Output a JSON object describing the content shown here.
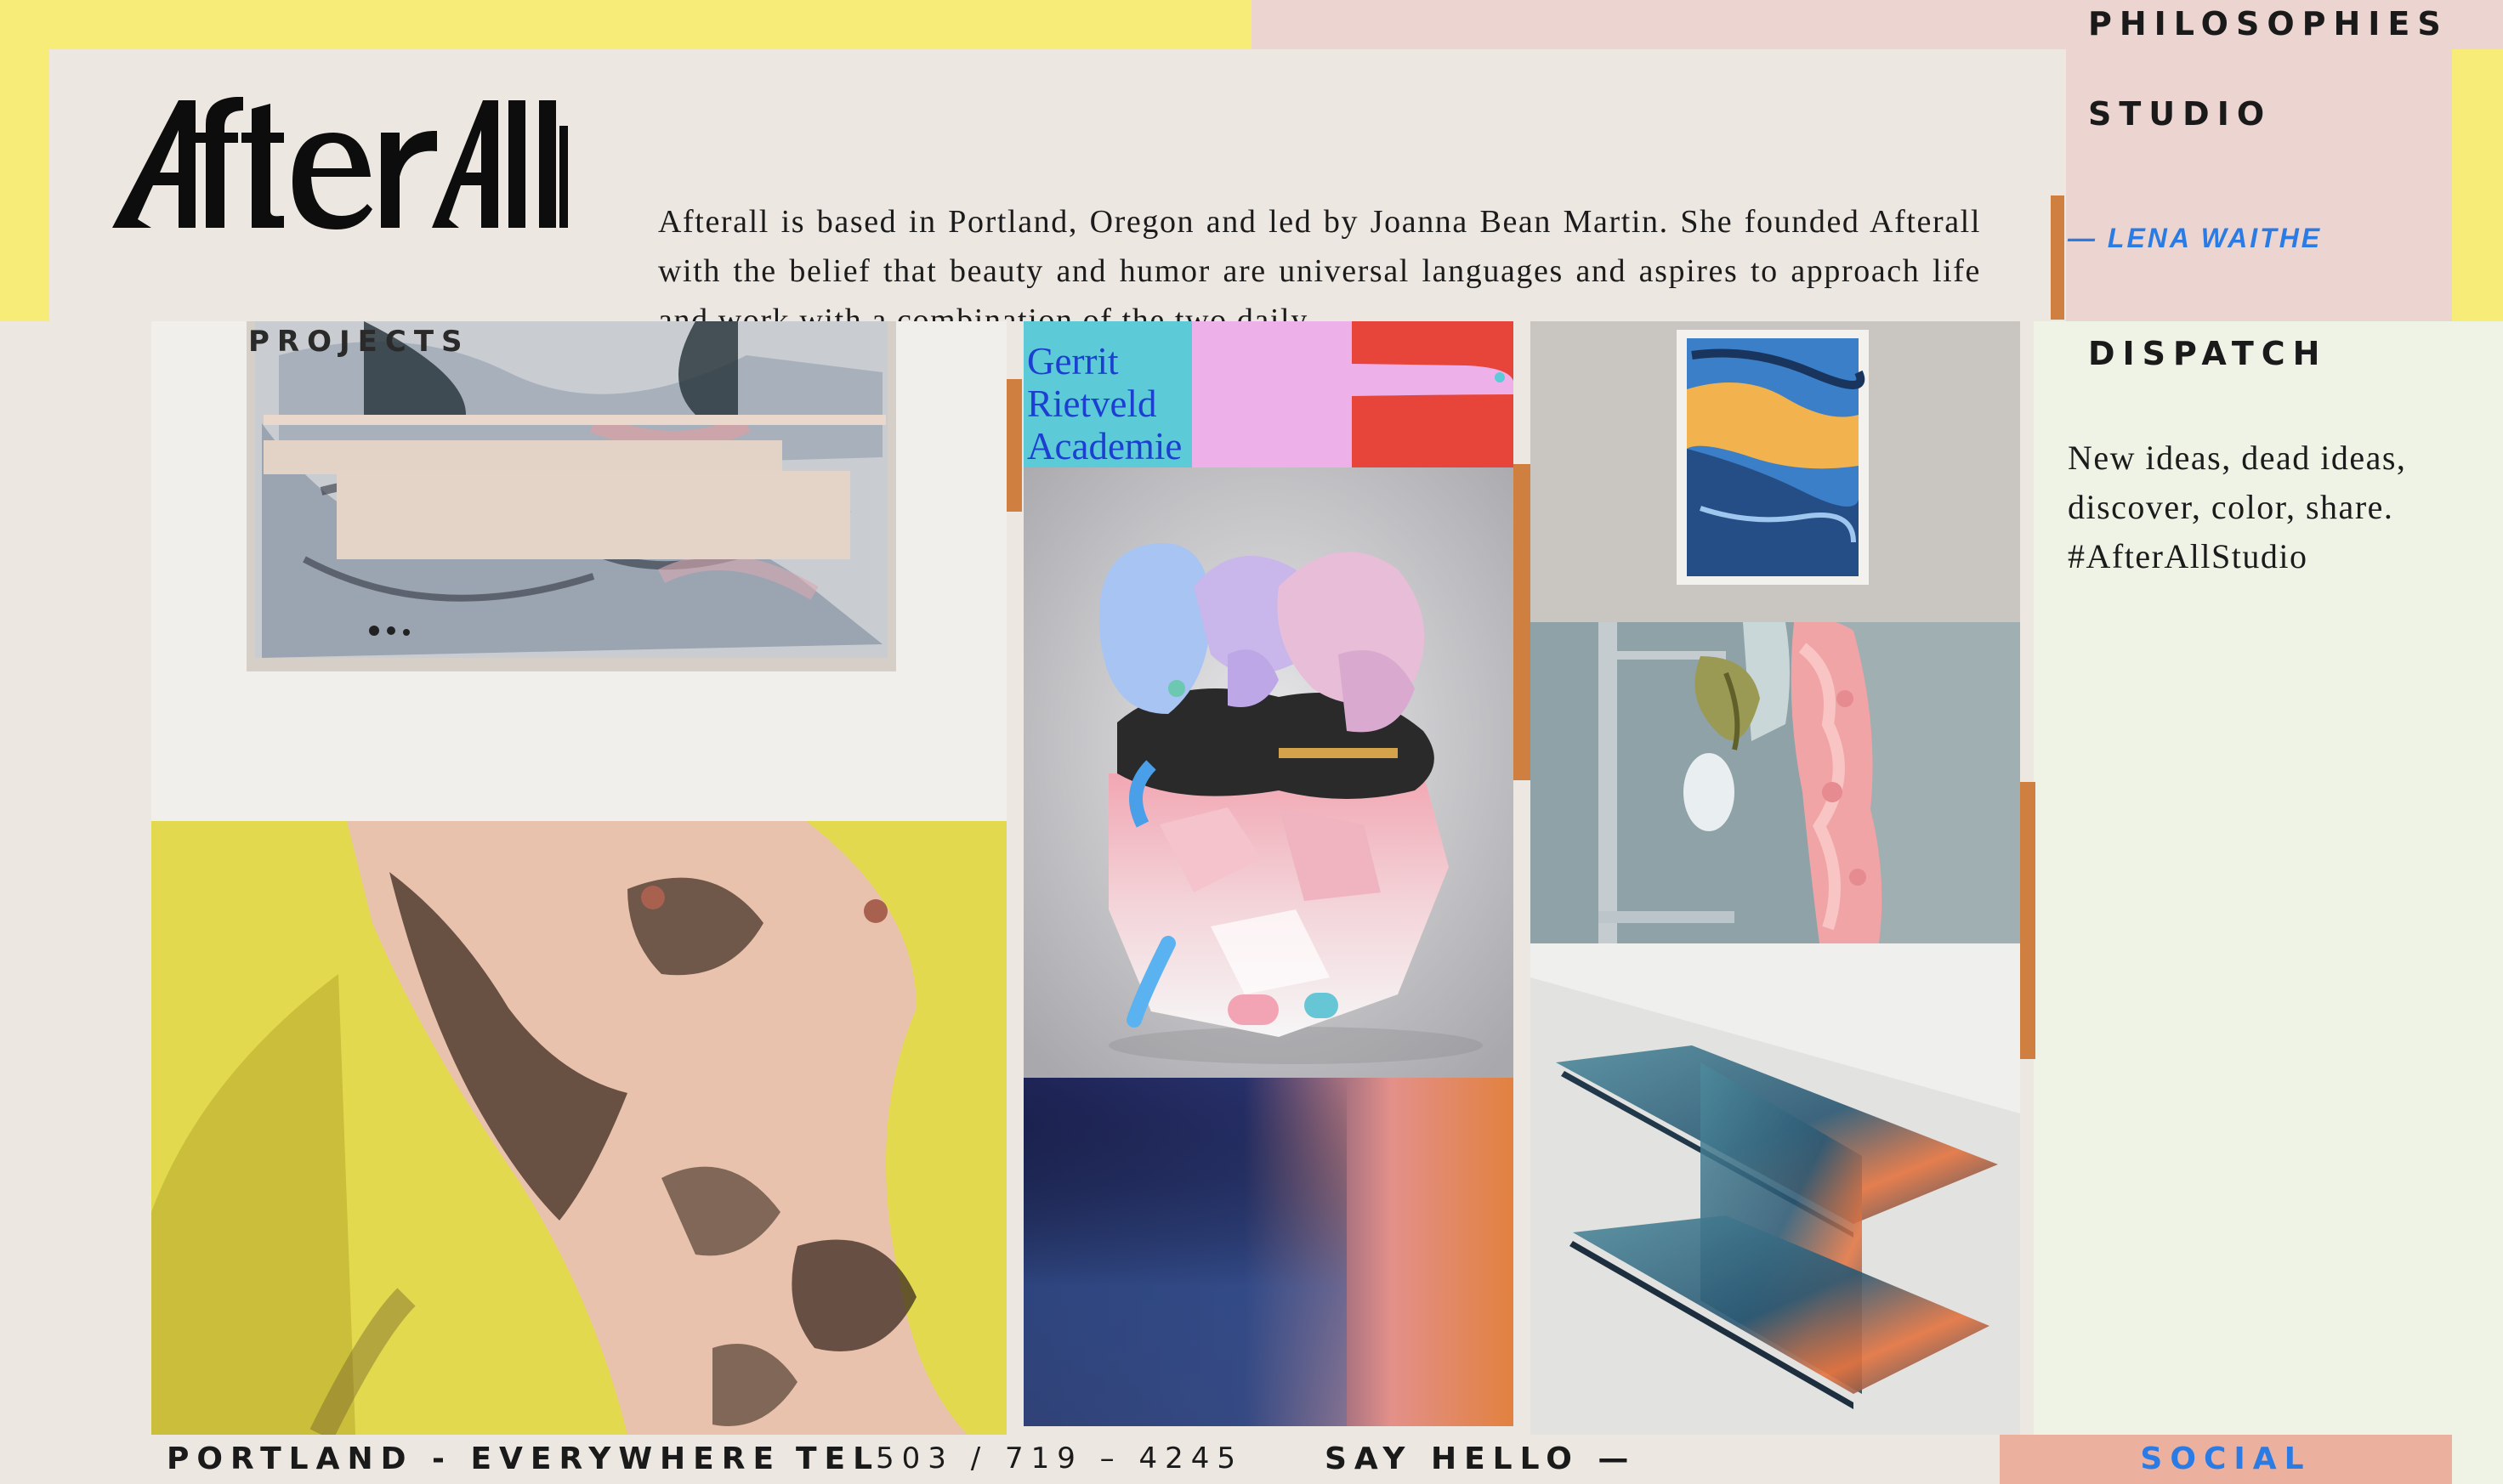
{
  "brand": {
    "logo_text": "AfterAll"
  },
  "about": {
    "text": "Afterall is based in Portland, Oregon and led by Joanna Bean Martin. She founded Afterall with the belief that beauty and humor are universal languages and aspires to approach life and work with a combination of the two daily."
  },
  "nav": {
    "philosophies": "PHILOSOPHIES",
    "studio": "STUDIO",
    "lena": "— LENA WAITHE",
    "projects": "PROJECTS",
    "dispatch": "DISPATCH"
  },
  "dispatch": {
    "text": "New ideas, dead ideas, discover, color, share. #AfterAllStudio"
  },
  "gallery": {
    "gerrit_lines": [
      "Gerrit",
      "Rietveld",
      "Academie"
    ]
  },
  "footer": {
    "location": "PORTLAND - EVERYWHERE",
    "tel_label": "TEL",
    "tel_number": "503 / 719 – 4245",
    "say_hello": "SAY HELLO —",
    "social": "SOCIAL"
  },
  "colors": {
    "yellow": "#f7ec78",
    "pink": "#ecd5d0",
    "green": "#eef3e6",
    "accent_orange": "#cf8040",
    "link_blue": "#2b7be4",
    "social_salmon": "#ecb09e"
  }
}
